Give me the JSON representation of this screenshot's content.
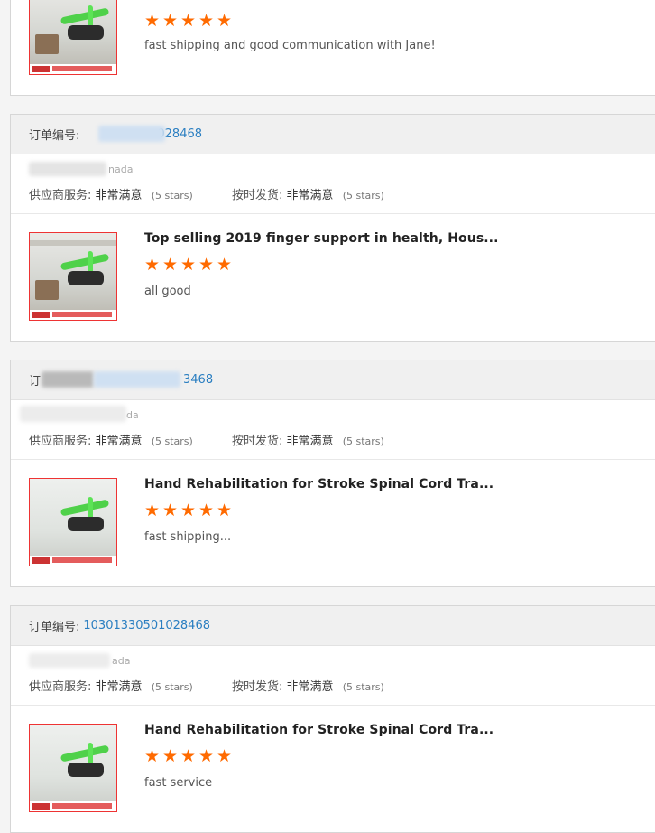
{
  "reviews": [
    {
      "order_label": "",
      "order_number": "",
      "buyer": "",
      "supplier_service_label": "",
      "supplier_service_value": "",
      "supplier_service_stars": "",
      "shipping_label": "",
      "shipping_value": "",
      "shipping_stars": "",
      "product_title": "",
      "rating": 5,
      "comment": "fast shipping and good communication with Jane!"
    },
    {
      "order_label": "订单编号:",
      "order_number": "028468",
      "buyer": "nada",
      "supplier_service_label": "供应商服务:",
      "supplier_service_value": "非常满意",
      "supplier_service_stars": "(5 stars)",
      "shipping_label": "按时发货:",
      "shipping_value": "非常满意",
      "shipping_stars": "(5 stars)",
      "product_title": "Top selling 2019 finger support in health, Hous...",
      "rating": 5,
      "comment": "all good"
    },
    {
      "order_label": "订",
      "order_number": "3468",
      "buyer": "da",
      "supplier_service_label": "供应商服务:",
      "supplier_service_value": "非常满意",
      "supplier_service_stars": "(5 stars)",
      "shipping_label": "按时发货:",
      "shipping_value": "非常满意",
      "shipping_stars": "(5 stars)",
      "product_title": "Hand Rehabilitation for Stroke Spinal Cord Tra...",
      "rating": 5,
      "comment": "fast shipping..."
    },
    {
      "order_label": "订单编号:",
      "order_number": "10301330501028468",
      "buyer": "ada",
      "supplier_service_label": "供应商服务:",
      "supplier_service_value": "非常满意",
      "supplier_service_stars": "(5 stars)",
      "shipping_label": "按时发货:",
      "shipping_value": "非常满意",
      "shipping_stars": "(5 stars)",
      "product_title": "Hand Rehabilitation for Stroke Spinal Cord Tra...",
      "rating": 5,
      "comment": "fast service"
    }
  ],
  "colors": {
    "star": "#ff6a00",
    "link": "#2a7ec1",
    "thumb_border": "#e33333"
  },
  "icons": {
    "star": "star-icon"
  }
}
